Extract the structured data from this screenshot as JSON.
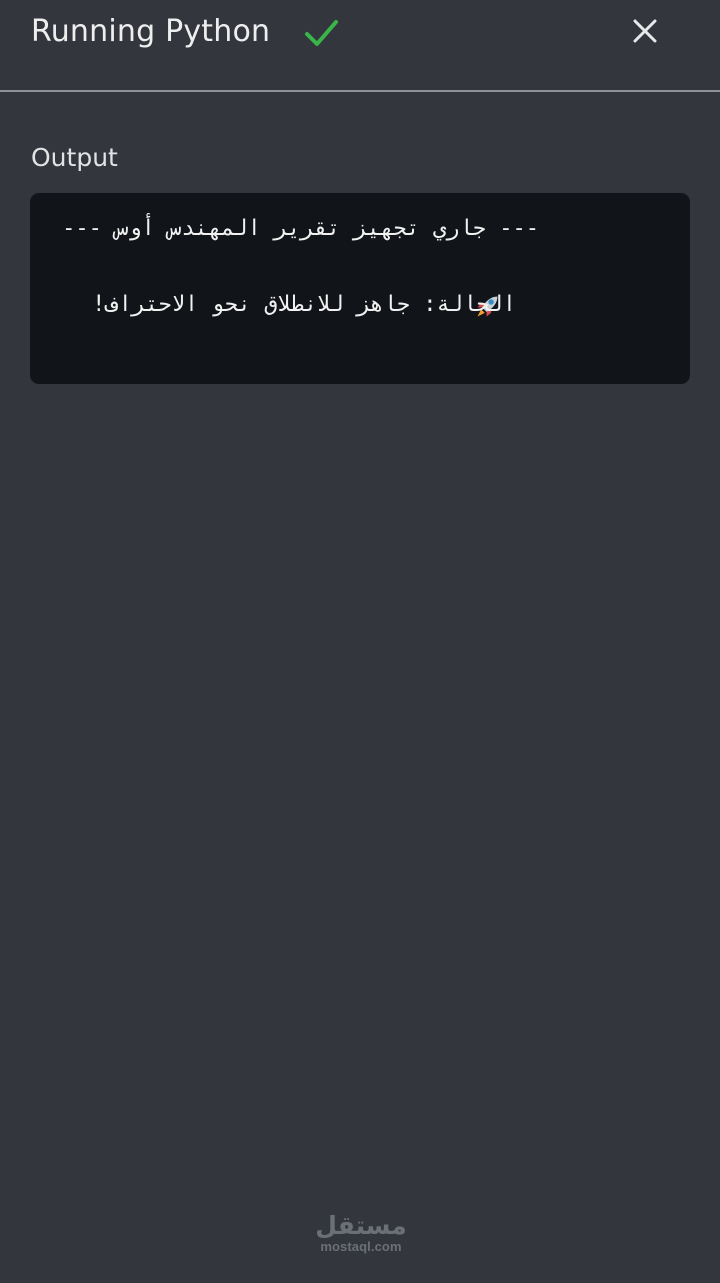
{
  "header": {
    "title": "Running Python",
    "status_icon": "checkmark-icon",
    "close_icon": "close-icon"
  },
  "output": {
    "label": "Output",
    "lines": [
      "--- جاري تجهيز تقرير المهندس أوس ---",
      "الحالة: جاهز للانطلاق نحو الاحتراف!"
    ],
    "line_icon": "rocket-icon"
  },
  "watermark": {
    "arabic": "مستقل",
    "domain": "mostaql.com"
  },
  "colors": {
    "background": "#33363c",
    "output_background": "#111418",
    "accent_success": "#39b54a",
    "text": "#e7e8ea"
  }
}
